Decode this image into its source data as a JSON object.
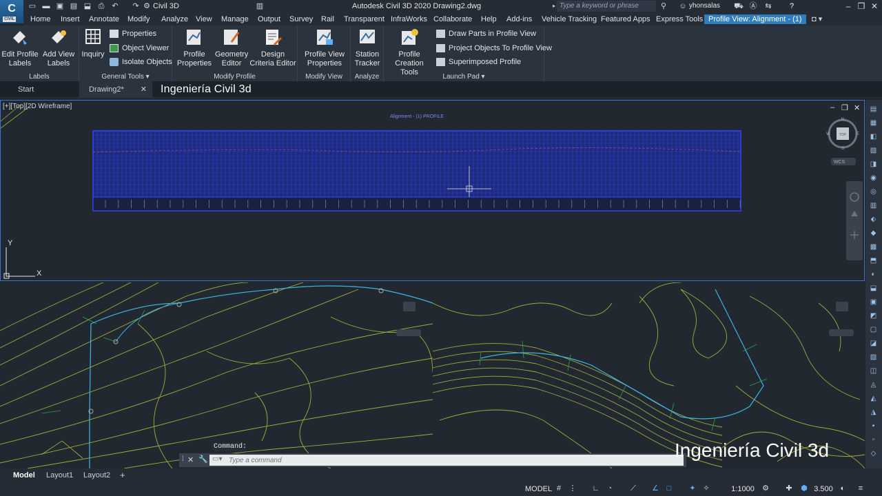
{
  "titlebar": {
    "app_logo": "C",
    "app_logo_sub": "CIVIL",
    "workspace": "Civil 3D",
    "title": "Autodesk Civil 3D 2020   Drawing2.dwg",
    "search_placeholder": "Type a keyword or phrase",
    "user": "yhonsalas"
  },
  "menu": {
    "items": [
      "Home",
      "Insert",
      "Annotate",
      "Modify",
      "Analyze",
      "View",
      "Manage",
      "Output",
      "Survey",
      "Rail",
      "Transparent",
      "InfraWorks",
      "Collaborate",
      "Help",
      "Add-ins",
      "Vehicle Tracking",
      "Featured Apps",
      "Express Tools"
    ],
    "active_tab": "Profile View: Alignment - (1)"
  },
  "ribbon": {
    "labels_panel": {
      "title": "Labels",
      "edit_profile_labels": "Edit Profile Labels",
      "add_view_labels": "Add View Labels"
    },
    "general_tools_panel": {
      "title": "General Tools",
      "inquiry": "Inquiry",
      "properties": "Properties",
      "object_viewer": "Object Viewer",
      "isolate_objects": "Isolate Objects"
    },
    "modify_profile_panel": {
      "title": "Modify Profile",
      "profile_properties": "Profile Properties",
      "geometry_editor": "Geometry Editor",
      "design_criteria_editor": "Design Criteria Editor"
    },
    "modify_view_panel": {
      "title": "Modify View",
      "profile_view_properties": "Profile View Properties"
    },
    "analyze_panel": {
      "title": "Analyze",
      "station_tracker": "Station Tracker"
    },
    "launch_pad_panel": {
      "title": "Launch Pad",
      "profile_creation_tools": "Profile Creation Tools",
      "draw_parts": "Draw Parts in Profile View",
      "project_objects": "Project Objects To Profile View",
      "superimposed_profile": "Superimposed Profile"
    }
  },
  "filetabs": {
    "start": "Start",
    "drawing": "Drawing2*"
  },
  "watermark": {
    "top": "Ingeniería Civil 3d",
    "bottom": "Ingeniería Civil 3d"
  },
  "viewport": {
    "label": "[+][Top][2D Wireframe]",
    "profile_title": "Alignment - (1) PROFILE",
    "viewcube_top": "TOP",
    "viewcube_n": "N",
    "viewcube_s": "S",
    "viewcube_e": "E",
    "viewcube_w": "W",
    "wcs": "WCS",
    "ucs_x": "X",
    "ucs_y": "Y"
  },
  "command": {
    "history": "Command:",
    "placeholder": "Type a command"
  },
  "layout_tabs": [
    "Model",
    "Layout1",
    "Layout2"
  ],
  "status": {
    "model": "MODEL",
    "scale": "1:1000",
    "annotation_value": "3.500"
  },
  "colors": {
    "accent": "#2f7dbd",
    "profile_grid": "#2f3fd6",
    "alignment": "#3fb6e8",
    "contours": "#9fae3c"
  }
}
